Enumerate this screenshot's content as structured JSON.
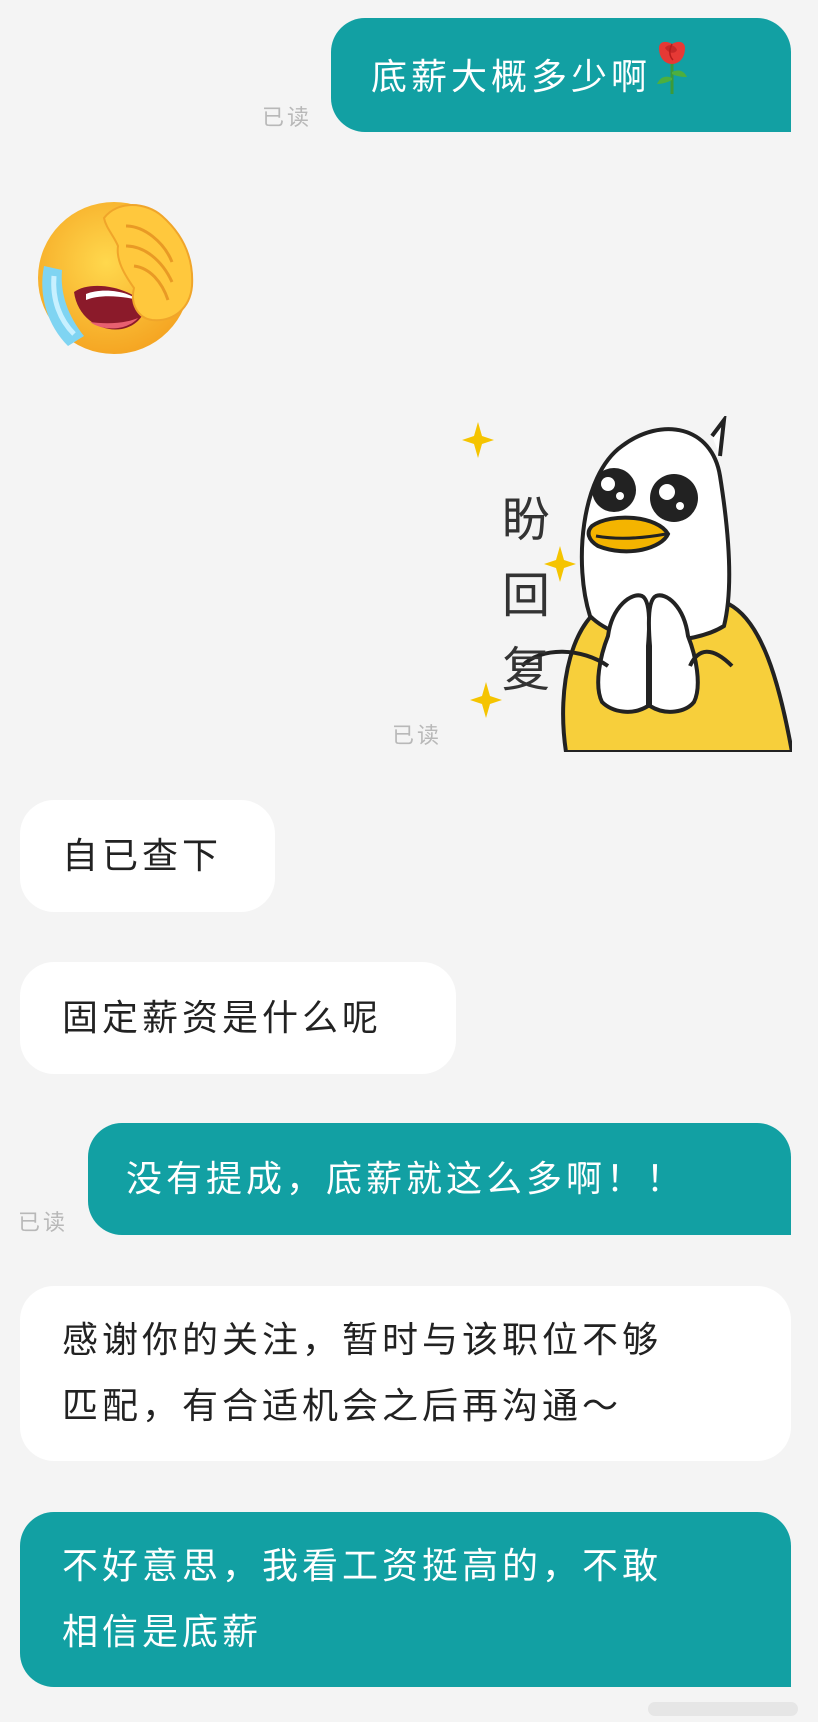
{
  "conversation": {
    "messages": [
      {
        "id": "m1",
        "direction": "outgoing",
        "type": "text",
        "text": "底薪大概多少啊",
        "trailing_icon": "rose-icon",
        "read_status": "已读"
      },
      {
        "id": "m2",
        "direction": "incoming",
        "type": "emoji",
        "emoji": "facepalm-crying-emoji"
      },
      {
        "id": "m3",
        "direction": "outgoing",
        "type": "sticker",
        "sticker_text": "盼回复",
        "sticker_char_1": "盼",
        "sticker_char_2": "回",
        "sticker_char_3": "复",
        "read_status": "已读"
      },
      {
        "id": "m4",
        "direction": "incoming",
        "type": "text",
        "text": "自已查下"
      },
      {
        "id": "m5",
        "direction": "incoming",
        "type": "text",
        "text": "固定薪资是什么呢"
      },
      {
        "id": "m6",
        "direction": "outgoing",
        "type": "text",
        "text": "没有提成，底薪就这么多啊！！",
        "read_status": "已读"
      },
      {
        "id": "m7",
        "direction": "incoming",
        "type": "text",
        "text_line_1": "感谢你的关注，暂时与该职位不够",
        "text_line_2": "匹配，有合适机会之后再沟通～"
      },
      {
        "id": "m8",
        "direction": "outgoing",
        "type": "text",
        "text_line_1": "不好意思，我看工资挺高的，不敢",
        "text_line_2": "相信是底薪"
      }
    ]
  },
  "colors": {
    "background": "#f4f4f4",
    "outgoing_bubble": "#12a0a3",
    "incoming_bubble": "#ffffff",
    "outgoing_text": "#ffffff",
    "incoming_text": "#222222",
    "read_status": "#b8b8b8",
    "sticker_sparkle": "#f5c400",
    "sticker_shirt": "#f7cf3b",
    "sticker_beak": "#f4b400"
  }
}
